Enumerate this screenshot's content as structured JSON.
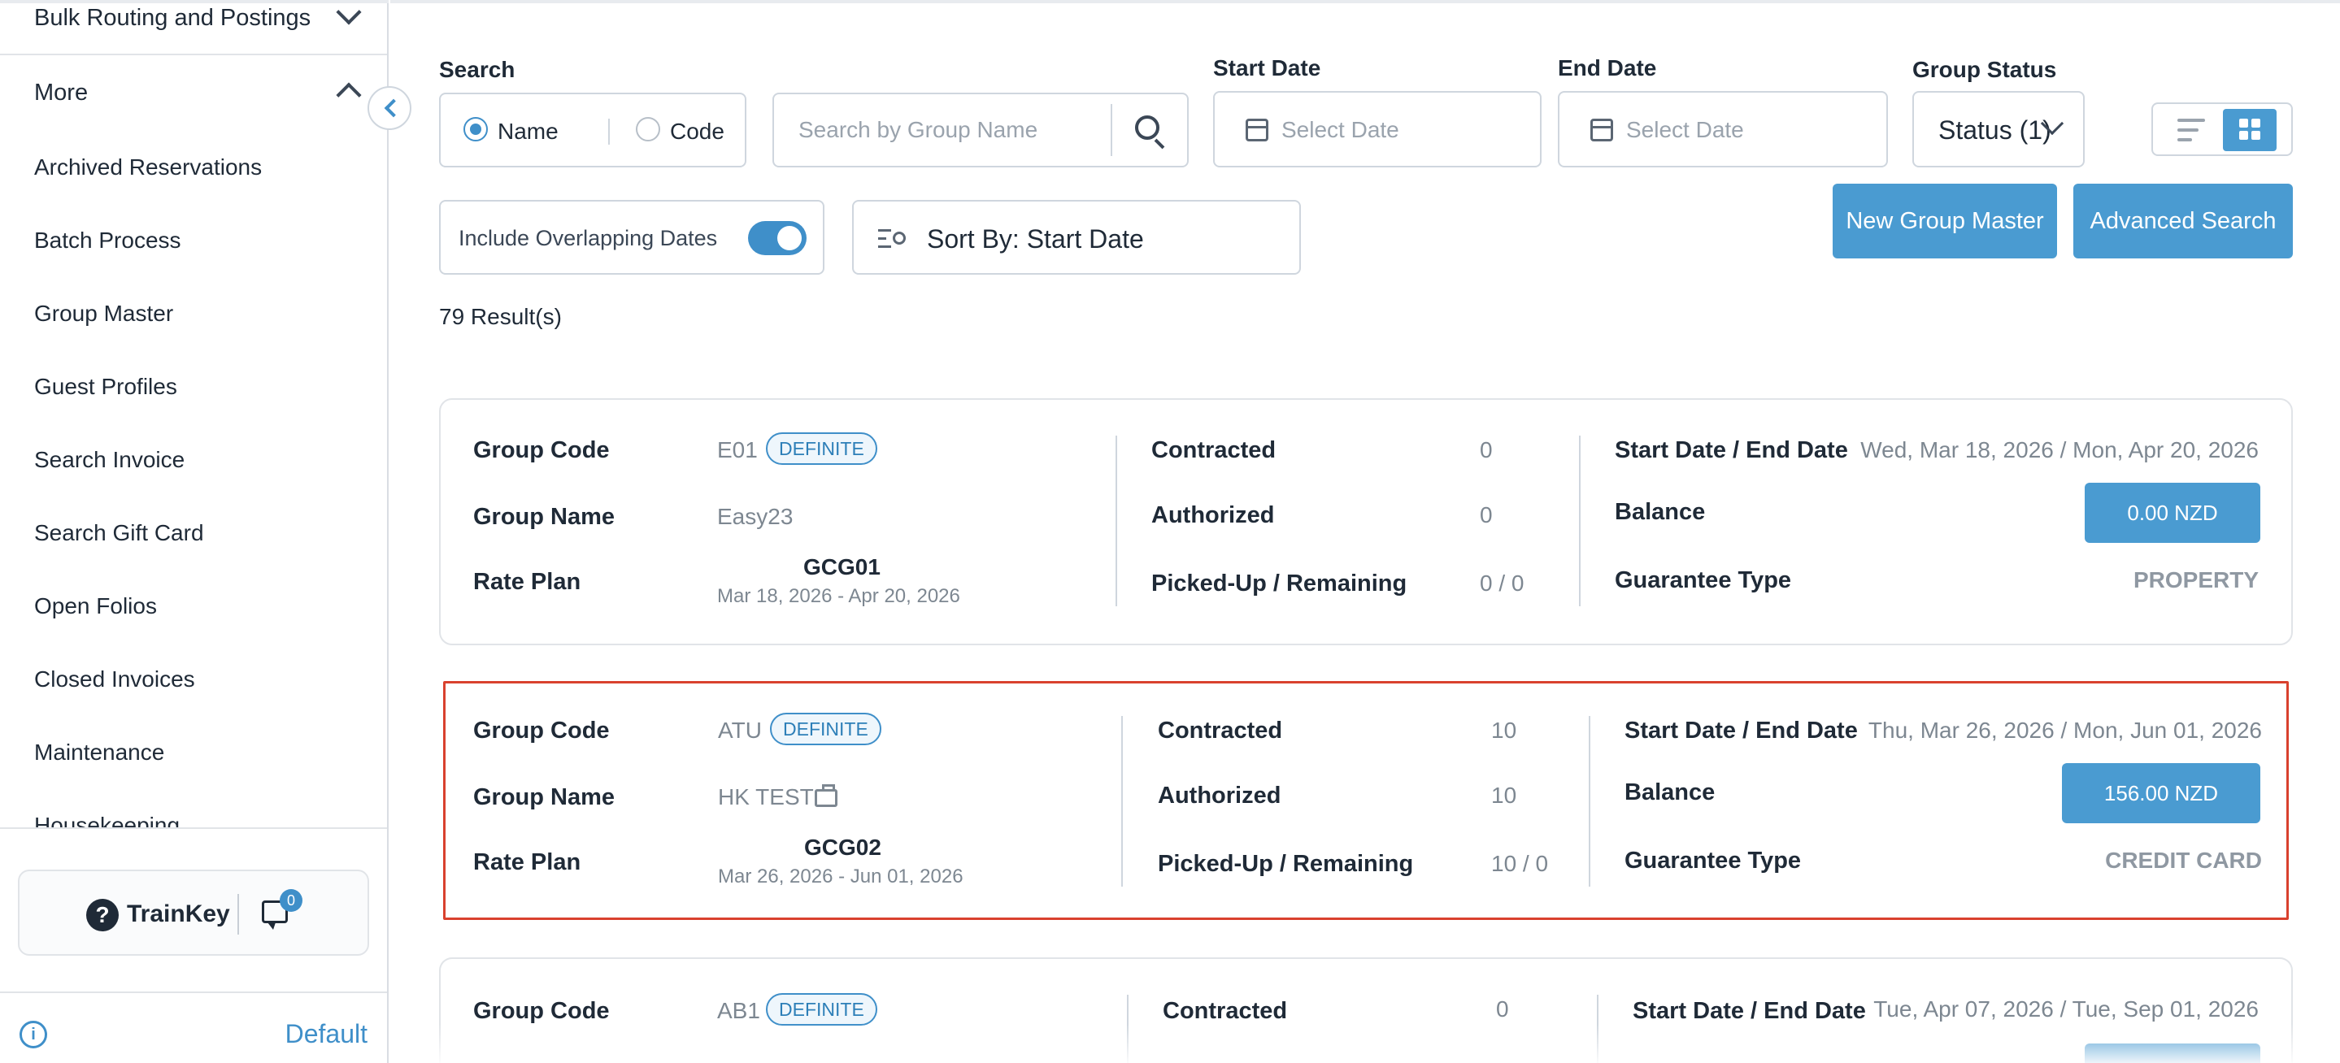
{
  "sidebar": {
    "bulk_routing": "Bulk Routing and Postings",
    "more": "More",
    "items": [
      "Archived Reservations",
      "Batch Process",
      "Group Master",
      "Guest Profiles",
      "Search Invoice",
      "Search Gift Card",
      "Open Folios",
      "Closed Invoices",
      "Maintenance",
      "Housekeeping"
    ],
    "trainkey": "TrainKey",
    "chat_count": "0",
    "default": "Default"
  },
  "filters": {
    "search_label": "Search",
    "radio_name": "Name",
    "radio_code": "Code",
    "search_placeholder": "Search by Group Name",
    "start_date_label": "Start Date",
    "start_date_placeholder": "Select Date",
    "end_date_label": "End Date",
    "end_date_placeholder": "Select Date",
    "group_status_label": "Group Status",
    "group_status_value": "Status (1)",
    "overlap_label": "Include Overlapping Dates",
    "sort_label": "Sort By: Start Date",
    "new_group_master": "New Group Master",
    "advanced_search": "Advanced Search",
    "results": "79 Result(s)"
  },
  "colors": {
    "accent": "#4a9bd1",
    "selected_border": "#d9412e"
  },
  "labels": {
    "group_code": "Group Code",
    "group_name": "Group Name",
    "rate_plan": "Rate Plan",
    "contracted": "Contracted",
    "authorized": "Authorized",
    "picked_up": "Picked-Up / Remaining",
    "start_end": "Start Date / End Date",
    "balance": "Balance",
    "guarantee": "Guarantee Type"
  },
  "cards": [
    {
      "code": "E01",
      "status": "DEFINITE",
      "name": "Easy23",
      "rate_plan": "GCG01",
      "rate_dates": "Mar 18, 2026 - Apr 20, 2026",
      "contracted": "0",
      "authorized": "0",
      "picked_up": "0 / 0",
      "start_end": "Wed, Mar 18, 2026 / Mon, Apr 20, 2026",
      "balance": "0.00 NZD",
      "guarantee": "PROPERTY"
    },
    {
      "code": "ATU",
      "status": "DEFINITE",
      "name": "HK TEST",
      "rate_plan": "GCG02",
      "rate_dates": "Mar 26, 2026 - Jun 01, 2026",
      "contracted": "10",
      "authorized": "10",
      "picked_up": "10 / 0",
      "start_end": "Thu, Mar 26, 2026 / Mon, Jun 01, 2026",
      "balance": "156.00 NZD",
      "guarantee": "CREDIT CARD"
    },
    {
      "code": "AB1",
      "status": "DEFINITE",
      "contracted": "0",
      "start_end": "Tue, Apr 07, 2026 / Tue, Sep 01, 2026"
    }
  ]
}
